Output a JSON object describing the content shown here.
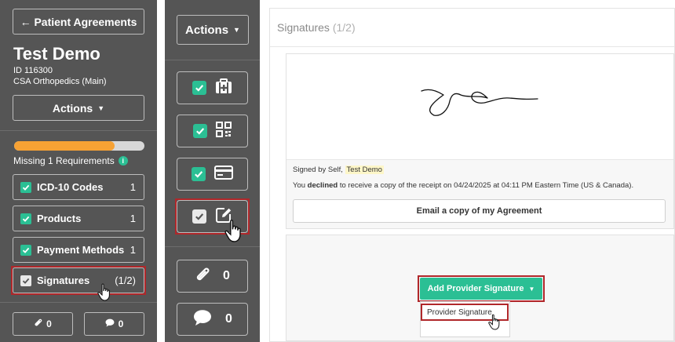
{
  "left": {
    "back_label": "← Patient Agreements",
    "patient_name": "Test Demo",
    "patient_id": "ID 116300",
    "clinic": "CSA Orthopedics (Main)",
    "actions_label": "Actions",
    "progress_fraction": 0.77,
    "missing_text": "Missing 1 Requirements",
    "requirements": [
      {
        "label": "ICD-10 Codes",
        "count": "1"
      },
      {
        "label": "Products",
        "count": "1"
      },
      {
        "label": "Payment Methods",
        "count": "1"
      },
      {
        "label": "Signatures",
        "count": "(1/2)"
      }
    ],
    "attachments_count": "0",
    "comments_count": "0"
  },
  "middle": {
    "actions_label": "Actions",
    "attachments_count": "0",
    "comments_count": "0"
  },
  "signatures": {
    "title": "Signatures",
    "count": "(1/2)",
    "signed_by_prefix": "Signed by Self,",
    "signer_name": "Test Demo",
    "declined_prefix": "You",
    "declined_word": "declined",
    "declined_suffix": "to receive a copy of the receipt on 04/24/2025 at 04:11 PM Eastern Time (US & Canada).",
    "email_button": "Email a copy of my Agreement",
    "add_provider_label": "Add Provider Signature",
    "dropdown_item": "Provider Signature"
  },
  "colors": {
    "panel_bg": "#555555",
    "accent_green": "#2bbf94",
    "progress_orange": "#f7a234",
    "highlight_red": "#b0272a"
  }
}
